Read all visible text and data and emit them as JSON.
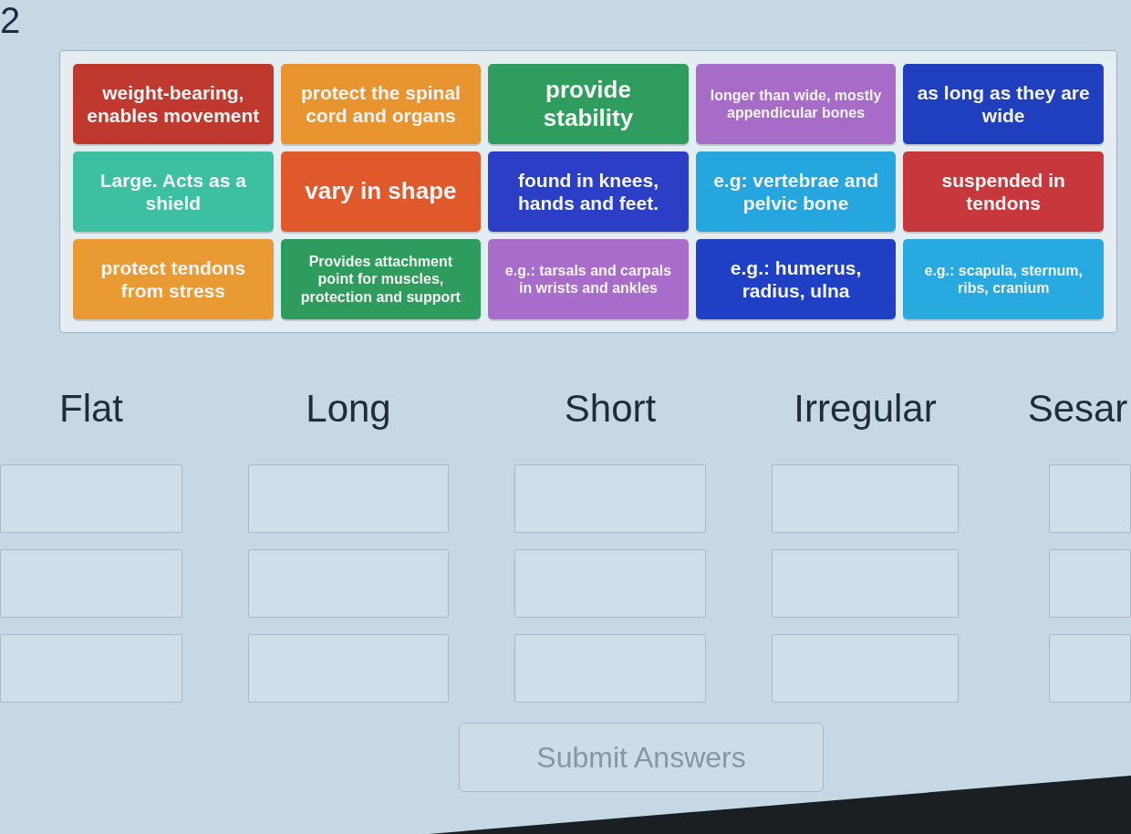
{
  "question_number": "2",
  "tiles": [
    {
      "text": "weight-bearing, enables movement",
      "color": "#c0392f"
    },
    {
      "text": "protect the spinal cord and organs",
      "color": "#e8952f"
    },
    {
      "text": "provide stability",
      "color": "#2f9d5e"
    },
    {
      "text": "longer than wide, mostly appendicular bones",
      "color": "#a66cc8"
    },
    {
      "text": "as long as they are wide",
      "color": "#1f3fbf"
    },
    {
      "text": "Large. Acts as a shield",
      "color": "#3dbfa2"
    },
    {
      "text": "vary in shape",
      "color": "#e0592a"
    },
    {
      "text": "found in knees, hands and feet.",
      "color": "#2a3ec6"
    },
    {
      "text": "e.g: vertebrae and pelvic bone",
      "color": "#26a6de"
    },
    {
      "text": "suspended in tendons",
      "color": "#c7383c"
    },
    {
      "text": "protect tendons from stress",
      "color": "#e99a33"
    },
    {
      "text": "Provides attachment point for muscles, protection and support",
      "color": "#2e9c5c"
    },
    {
      "text": "e.g.: tarsals and carpals in wrists and ankles",
      "color": "#a86dca"
    },
    {
      "text": "e.g.: humerus, radius, ulna",
      "color": "#1f40c4"
    },
    {
      "text": "e.g.: scapula, sternum, ribs, cranium",
      "color": "#28a9e0"
    }
  ],
  "categories": [
    {
      "label": "Flat",
      "drop_zones": [
        {
          "kind": "empty"
        },
        {
          "kind": "empty"
        },
        {
          "kind": "empty"
        }
      ]
    },
    {
      "label": "Long",
      "drop_zones": [
        {
          "kind": "empty"
        },
        {
          "kind": "empty"
        },
        {
          "kind": "empty"
        }
      ]
    },
    {
      "label": "Short",
      "drop_zones": [
        {
          "kind": "empty"
        },
        {
          "kind": "empty"
        },
        {
          "kind": "empty"
        }
      ]
    },
    {
      "label": "Irregular",
      "drop_zones": [
        {
          "kind": "empty"
        },
        {
          "kind": "empty"
        },
        {
          "kind": "empty"
        }
      ]
    },
    {
      "label": "Sesar",
      "drop_zones": [
        {
          "kind": "empty"
        },
        {
          "kind": "empty"
        },
        {
          "kind": "empty"
        }
      ]
    }
  ],
  "submit": {
    "label": "Submit Answers",
    "disabled": true
  }
}
